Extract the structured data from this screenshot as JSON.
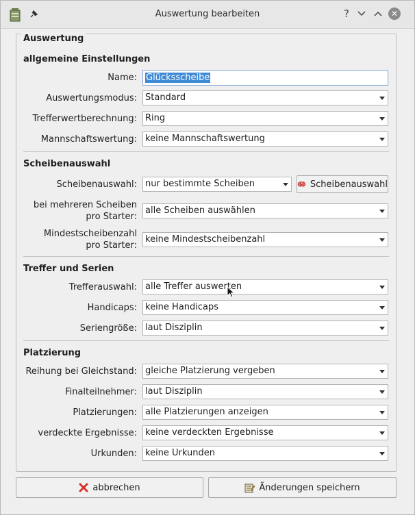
{
  "window": {
    "title": "Auswertung bearbeiten"
  },
  "group": {
    "legend": "Auswertung"
  },
  "sections": {
    "general": "allgemeine Einstellungen",
    "targets": "Scheibenauswahl",
    "hits": "Treffer und Serien",
    "placing": "Platzierung"
  },
  "fields": {
    "name_label": "Name:",
    "name_value": "Glücksscheibe",
    "mode_label": "Auswertungsmodus:",
    "mode_value": "Standard",
    "calc_label": "Trefferwertberechnung:",
    "calc_value": "Ring",
    "team_label": "Mannschaftswertung:",
    "team_value": "keine Mannschaftswertung",
    "target_sel_label": "Scheibenauswahl:",
    "target_sel_value": "nur bestimmte Scheiben",
    "target_sel_button": "Scheibenauswahl",
    "multi_label_1": "bei mehreren Scheiben",
    "multi_label_2": "pro Starter:",
    "multi_value": "alle Scheiben auswählen",
    "min_label_1": "Mindestscheibenzahl",
    "min_label_2": "pro Starter:",
    "min_value": "keine Mindestscheibenzahl",
    "hit_sel_label": "Trefferauswahl:",
    "hit_sel_value": "alle Treffer auswerten",
    "handicap_label": "Handicaps:",
    "handicap_value": "keine Handicaps",
    "series_label": "Seriengröße:",
    "series_value": "laut Disziplin",
    "tie_label": "Reihung bei Gleichstand:",
    "tie_value": "gleiche Platzierung vergeben",
    "final_label": "Finalteilnehmer:",
    "final_value": "laut Disziplin",
    "places_label": "Platzierungen:",
    "places_value": "alle Platzierungen anzeigen",
    "hidden_label": "verdeckte Ergebnisse:",
    "hidden_value": "keine verdeckten Ergebnisse",
    "cert_label": "Urkunden:",
    "cert_value": "keine Urkunden"
  },
  "buttons": {
    "cancel": "abbrechen",
    "save": "Änderungen speichern"
  },
  "icons": {
    "app": "app-icon",
    "pin": "pin-icon",
    "help": "help-icon",
    "minimize": "chevron-down-icon",
    "maximize": "chevron-up-icon",
    "close": "close-icon",
    "targets": "targets-icon",
    "cancel": "cancel-x-icon",
    "save": "save-edit-icon"
  },
  "colors": {
    "selection": "#3f8ad6",
    "cancel_red": "#d8322b"
  }
}
